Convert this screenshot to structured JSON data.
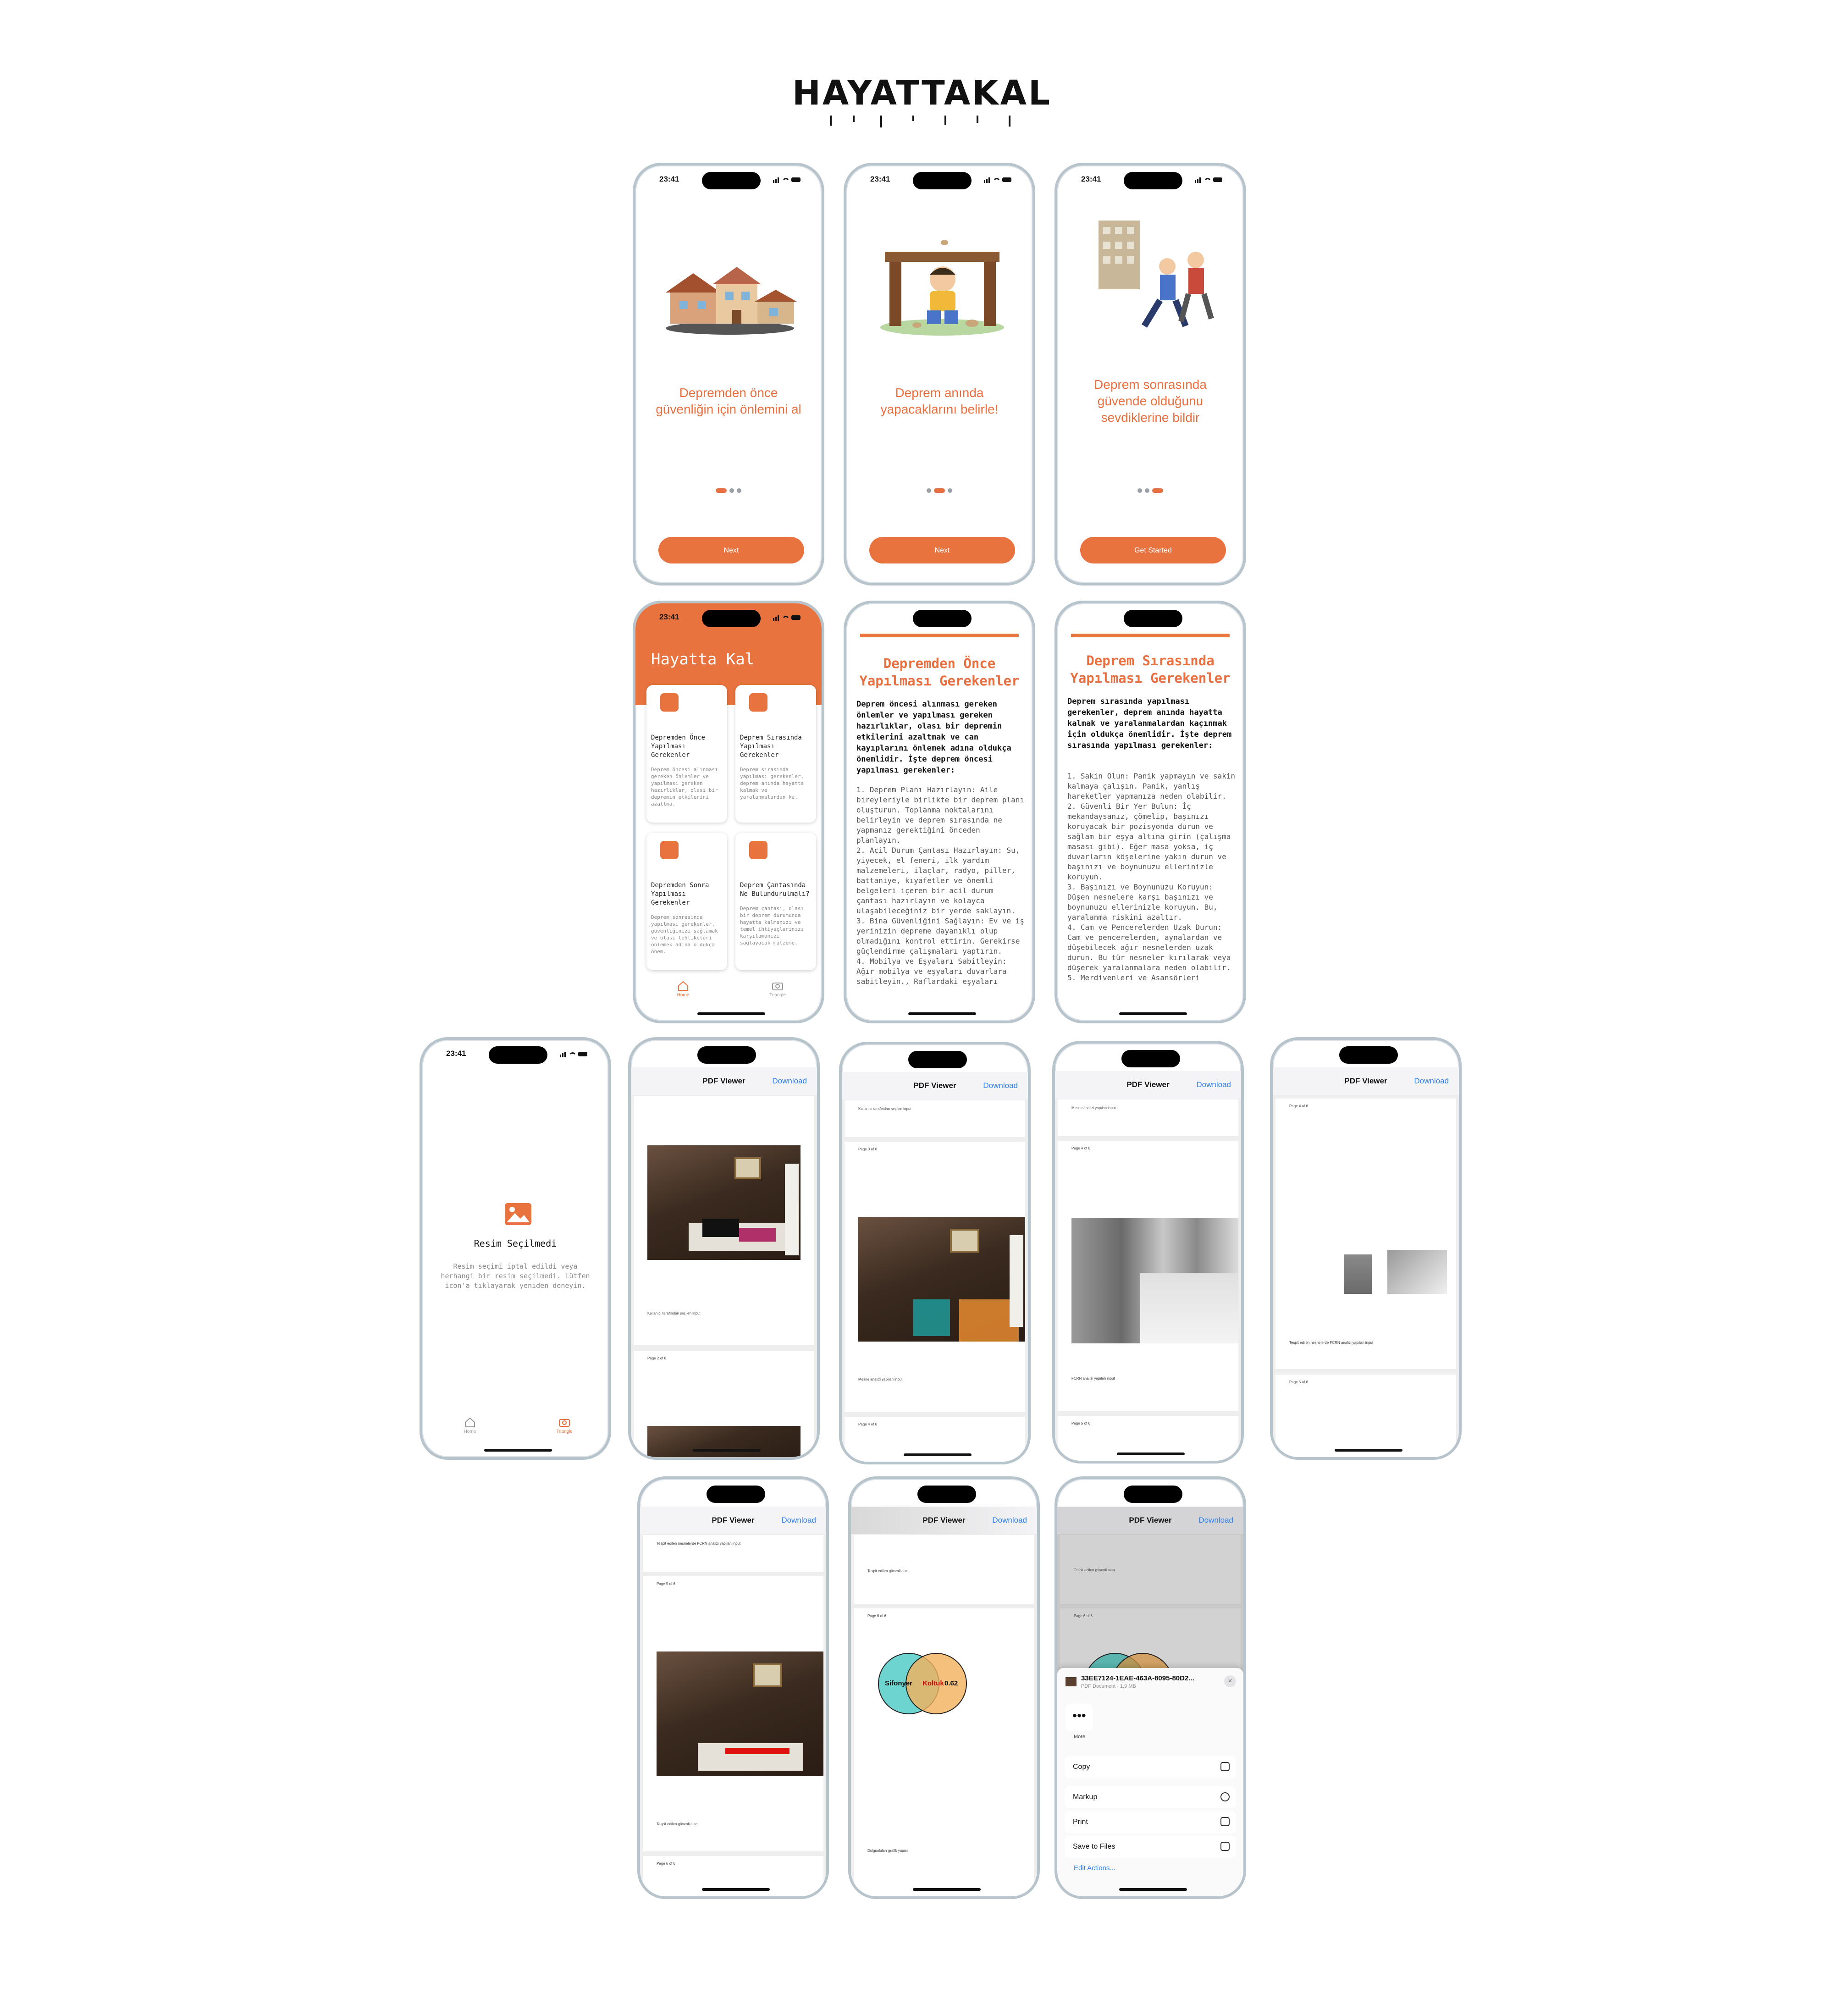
{
  "app": {
    "logo": "HAYATTAKAL"
  },
  "status": {
    "time": "23:41"
  },
  "onboarding": [
    {
      "title": "Depremden önce güvenliğin için önlemini al",
      "button": "Next"
    },
    {
      "title": "Deprem anında yapacaklarını belirle!",
      "button": "Next"
    },
    {
      "title": "Deprem sonrasında güvende olduğunu sevdiklerine bildir",
      "button": "Get Started"
    }
  ],
  "home": {
    "title": "Hayatta Kal",
    "cards": [
      {
        "title": "Depremden Önce Yapılması Gerekenler",
        "desc": "Deprem öncesi alınması gereken önlemler ve yapılması gereken hazırlıklar, olası bir depremin etkilerini azaltma."
      },
      {
        "title": "Deprem Sırasında Yapılması Gerekenler",
        "desc": "Deprem sırasında yapılması gerekenler, deprem anında hayatta kalmak ve yaralanmalardan ka."
      },
      {
        "title": "Depremden Sonra Yapılması Gerekenler",
        "desc": "Deprem sonrasında yapılması gerekenler, güvenliğinizi sağlamak ve olası tehlikeleri önlemek adına oldukça önem."
      },
      {
        "title": "Deprem Çantasında Ne Bulundurulmalı?",
        "desc": "Deprem çantası, olası bir deprem durumunda hayatta kalmanızı ve temel ihtiyaçlarınızı karşılamanızı sağlayacak malzeme."
      }
    ],
    "tabs": {
      "home": "Home",
      "triangle": "Triangle"
    }
  },
  "article_before": {
    "title": "Depremden Önce Yapılması Gerekenler",
    "lead": "Deprem öncesi alınması gereken önlemler ve yapılması gereken hazırlıklar, olası bir depremin etkilerini azaltmak ve can kayıplarını önlemek adına oldukça önemlidir. İşte deprem öncesi yapılması gerekenler:",
    "body": "1. Deprem Planı Hazırlayın: Aile bireyleriyle birlikte bir deprem planı oluşturun. Toplanma noktalarını belirleyin ve deprem sırasında ne yapmanız gerektiğini önceden planlayın.\n2. Acil Durum Çantası Hazırlayın: Su, yiyecek, el feneri, ilk yardım malzemeleri, ilaçlar, radyo, piller, battaniye, kıyafetler ve önemli belgeleri içeren bir acil durum çantası hazırlayın ve kolayca ulaşabileceğiniz bir yerde saklayın.\n3. Bina Güvenliğini Sağlayın: Ev ve iş yerinizin depreme dayanıklı olup olmadığını kontrol ettirin. Gerekirse güçlendirme çalışmaları yaptırın.\n4. Mobilya ve Eşyaları Sabitleyin: Ağır mobilya ve eşyaları duvarlara sabitleyin., Raflardaki eşyaları"
  },
  "article_during": {
    "title": "Deprem Sırasında Yapılması Gerekenler",
    "lead": "Deprem sırasında yapılması gerekenler, deprem anında hayatta kalmak ve yaralanmalardan kaçınmak için oldukça önemlidir. İşte deprem sırasında yapılması gerekenler:",
    "body": "1. Sakin Olun: Panik yapmayın ve sakin kalmaya çalışın. Panik, yanlış hareketler yapmanıza neden olabilir.\n2. Güvenli Bir Yer Bulun: İç mekandaysanız, çömelip, başınızı koruyacak bir pozisyonda durun ve sağlam bir eşya altına girin (çalışma masası gibi). Eğer masa yoksa, iç duvarların köşelerine yakın durun ve başınızı ve boynunuzu ellerinizle koruyun.\n3. Başınızı ve Boynunuzu Koruyun: Düşen nesnelere karşı başınızı ve boynunuzu ellerinizle koruyun. Bu, yaralanma riskini azaltır.\n4. Cam ve Pencerelerden Uzak Durun: Cam ve pencerelerden, aynalardan ve düşebilecek ağır nesnelerden uzak durun. Bu tür nesneler kırılarak veya düşerek yaralanmalara neden olabilir.\n5. Merdivenleri ve Asansörleri"
  },
  "no_image": {
    "title": "Resim Seçilmedi",
    "desc": "Resim seçimi iptal edildi veya herhangi bir resim seçilmedi. Lütfen icon'a tıklayarak yeniden deneyin."
  },
  "pdf": {
    "title": "PDF Viewer",
    "download": "Download",
    "captions": {
      "user_photo": "Kullanıcı tarafından seçilen input",
      "depth_input": "Mesne analizi yapılan input",
      "fcrn_input": "FCRN analizi yapılan input",
      "fcrn_model": "Tespit edilen nesnelerde FCRN analizi yapılan input",
      "safe_area": "Tespit edilen güvenli alan",
      "venn": "Dolgunluları grafik yapısı"
    },
    "pages": [
      "Page 2 of 6",
      "Page 3 of 6",
      "Page 4 of 6",
      "Page 5 of 6",
      "Page 6 of 6"
    ],
    "venn": {
      "left": "Sifonyer",
      "mid": "Koltuk",
      "value": "0.62"
    }
  },
  "share": {
    "filename": "33EE7124-1EAE-463A-8095-80D2...",
    "meta": "PDF Document · 1,9 MB",
    "more": "More",
    "actions": [
      "Copy",
      "Markup",
      "Print",
      "Save to Files"
    ],
    "edit": "Edit Actions..."
  }
}
